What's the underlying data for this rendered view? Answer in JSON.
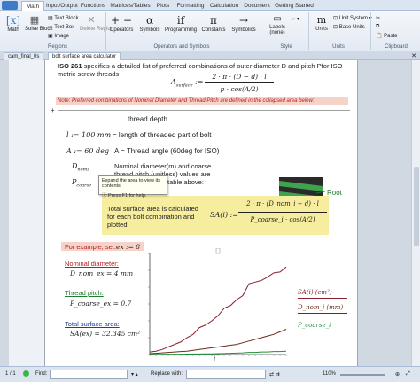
{
  "tabs": [
    "Math",
    "Input/Output",
    "Functions",
    "Matrices/Tables",
    "Plots",
    "Formatting",
    "Calculation",
    "Document",
    "Getting Started"
  ],
  "ribbon": {
    "math": "Math",
    "solve_block": "Solve Block",
    "text_block": "Text Block",
    "text_box": "Text Box",
    "image": "Image",
    "delete_region": "Delete Region",
    "operators": "Operators",
    "symbols": "Symbols",
    "programming": "Programming",
    "constants": "Constants",
    "symbolics": "Symbolics",
    "labels": "Labels",
    "labels_value": "(none)",
    "units": "Units",
    "unit_system": "Unit System",
    "base_units": "Base Units",
    "paste": "Paste",
    "groups": [
      "Regions",
      "Operators and Symbols",
      "Style",
      "Units",
      "Clipboard"
    ]
  },
  "doc_tabs": [
    "cam_final_0s",
    "bolt surface area calculator"
  ],
  "doc": {
    "intro_bold": "ISO 261",
    "intro_rest": "specifies a detailed list of preferred combinations of outer diameter D and pitch Pfor ISO metric screw threads",
    "area_formula_lhs": "A",
    "area_formula_sub": "surface",
    "area_num": "2 · π · (D − d) · l",
    "area_den": "p · cos(A/2)",
    "note": "Note: Preferred combinations of Nominal Diameter and Thread Pitch are defined in the collapsed area below:",
    "def_thread_depth": "thread depth",
    "def_l_val": "l := 100 mm",
    "def_l_text": "= length of threaded part of bolt",
    "def_A_val": "A := 60 deg",
    "def_A_text": "A = Thread angle (60deg for ISO)",
    "def_D_sym": "D",
    "def_D_sub": "noms",
    "def_P_sym": "P",
    "def_P_sub": "coarse",
    "def_DP_text": "Nominal diameter(m) and coarse thread pitch (unitless) values are used from hidden table above:",
    "root_label": "Root",
    "calc_text": "Total surface area is calculated for each bolt combination and plotted:",
    "sa_lhs": "SA(i) :=",
    "sa_num": "2 · π · (D_nom_i − d) · l",
    "sa_den": "P_coarse_i · cos(A/2)",
    "example_text": "For example, set:",
    "example_val": "ex := 8",
    "nominal_label": "Nominal diameter:",
    "nominal_val": "D_nom_ex = 4 mm",
    "pitch_label": "Thread pitch:",
    "pitch_val": "P_coarse_ex = 0.7",
    "total_label": "Total surface area:",
    "total_val": "SA(ex) = 32.345 cm²",
    "legend_sa": "SA(i) (cm²)",
    "legend_d": "D_nom_i (mm)",
    "legend_p": "P_coarse_i",
    "axis_i": "i",
    "marker_glyph": "+",
    "tooltip_1": "Expand the area to view its contents",
    "tooltip_2": "Press F1 for help."
  },
  "status": {
    "page": "1 / 1",
    "find": "Find:",
    "replace": "Replace with:",
    "zoom": "110%"
  },
  "chart_data": {
    "type": "line",
    "x": [
      0,
      1,
      2,
      3,
      4,
      5,
      6,
      7,
      8,
      9,
      10,
      11,
      12,
      13,
      14,
      15,
      16,
      17,
      18,
      19,
      20,
      21,
      22
    ],
    "xlim": [
      0,
      22
    ],
    "ylim": [
      0,
      120
    ],
    "grid": false,
    "series": [
      {
        "name": "SA(i) (cm²)",
        "color": "#8a1f2e",
        "values": [
          3,
          4,
          6,
          9,
          12,
          15,
          20,
          24,
          32,
          35,
          40,
          46,
          55,
          58,
          65,
          70,
          84,
          86,
          88,
          92,
          97,
          98,
          104
        ]
      },
      {
        "name": "D_nom_i (mm)",
        "color": "#6a2a1a",
        "values": [
          1,
          1.5,
          2,
          2.5,
          3,
          3.5,
          4,
          5,
          6,
          7,
          8,
          9,
          10,
          11,
          12,
          14,
          16,
          18,
          20,
          22,
          24,
          27,
          30
        ]
      },
      {
        "name": "P_coarse_i",
        "color": "#1d8f3a",
        "values": [
          0.2,
          0.25,
          0.3,
          0.35,
          0.4,
          0.45,
          0.5,
          0.6,
          0.7,
          0.75,
          0.8,
          1,
          1.25,
          1.5,
          1.75,
          2,
          2.5,
          2.5,
          3,
          3,
          3.5,
          3.5,
          4
        ]
      }
    ]
  },
  "colors": {
    "accent": "#3d7cc9",
    "highlight": "#f6ed9e",
    "pink": "#f7d2c9"
  }
}
